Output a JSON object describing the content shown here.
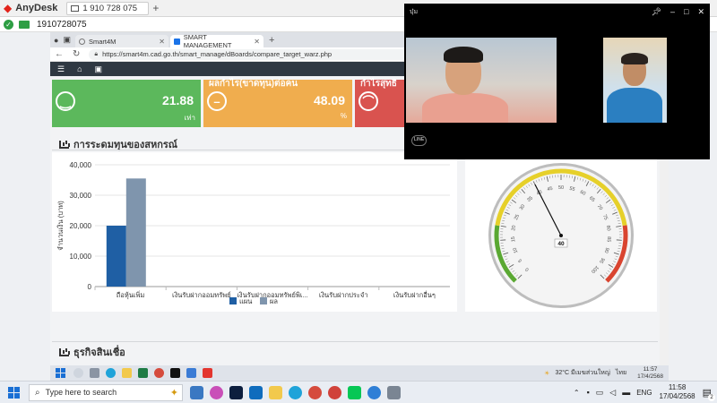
{
  "anydesk": {
    "brand": "AnyDesk",
    "tab_label": "1 910 728 075",
    "add_label": "+",
    "address": "1910728075"
  },
  "browser": {
    "tabs": [
      {
        "label": "Smart4M"
      },
      {
        "label": "SMART MANAGEMENT"
      }
    ],
    "new_tab": "+",
    "url": "https://smart4m.cad.go.th/smart_manage/dBoards/compare_target_warz.php"
  },
  "kpis": [
    {
      "label": "",
      "value": "21.88",
      "unit": "เท่า",
      "color": "#5cb85c"
    },
    {
      "label": "ผลกำไร(ขาดทุน)ต่อคน",
      "value": "48.09",
      "unit": "%",
      "color": "#f0ad4e"
    },
    {
      "label": "กำไรสุทธิ",
      "value": "",
      "unit": "",
      "color": "#d9534f"
    }
  ],
  "sections": {
    "capital_title": "การระดมทุนของสหกรณ์",
    "credit_title": "ธุรกิจสินเชื่อ"
  },
  "chart_data": {
    "type": "bar",
    "categories": [
      "ถือหุ้นเพิ่ม",
      "เงินรับฝากออมทรัพย์",
      "เงินรับฝากออมทรัพย์พิเ...",
      "เงินรับฝากประจำ",
      "เงินรับฝากอื่นๆ"
    ],
    "series": [
      {
        "name": "แผน",
        "color": "#1f5fa4",
        "values": [
          20000,
          0,
          0,
          0,
          0
        ]
      },
      {
        "name": "ผล",
        "color": "#7f95ad",
        "values": [
          35500,
          0,
          0,
          0,
          0
        ]
      }
    ],
    "ylabel": "จำนวนเงิน (บาท)",
    "ylim": [
      0,
      40000
    ],
    "yticks": [
      "0",
      "10,000",
      "20,000",
      "30,000",
      "40,000"
    ],
    "grid": true,
    "legend": "bottom"
  },
  "gauge": {
    "value": 40,
    "value_label": "40",
    "min": 0,
    "max": 100,
    "ticks": [
      "0",
      "5",
      "10",
      "15",
      "20",
      "25",
      "30",
      "35",
      "40",
      "45",
      "50",
      "55",
      "60",
      "65",
      "70",
      "75",
      "80",
      "85",
      "90",
      "95",
      "100"
    ],
    "colors": {
      "low": "#5aa832",
      "mid": "#e6d02a",
      "high": "#d9442f"
    }
  },
  "video_call": {
    "title": "บุ๋ม",
    "logo": "LINE"
  },
  "inner_taskbar": {
    "weather": "32°C มีเมฆส่วนใหญ่",
    "lang": "ไทย",
    "time": "11:57",
    "date": "17/4/2568"
  },
  "taskbar": {
    "search_placeholder": "Type here to search",
    "lang": "ENG",
    "time": "11:58",
    "date": "17/04/2568",
    "notifications": "2"
  }
}
